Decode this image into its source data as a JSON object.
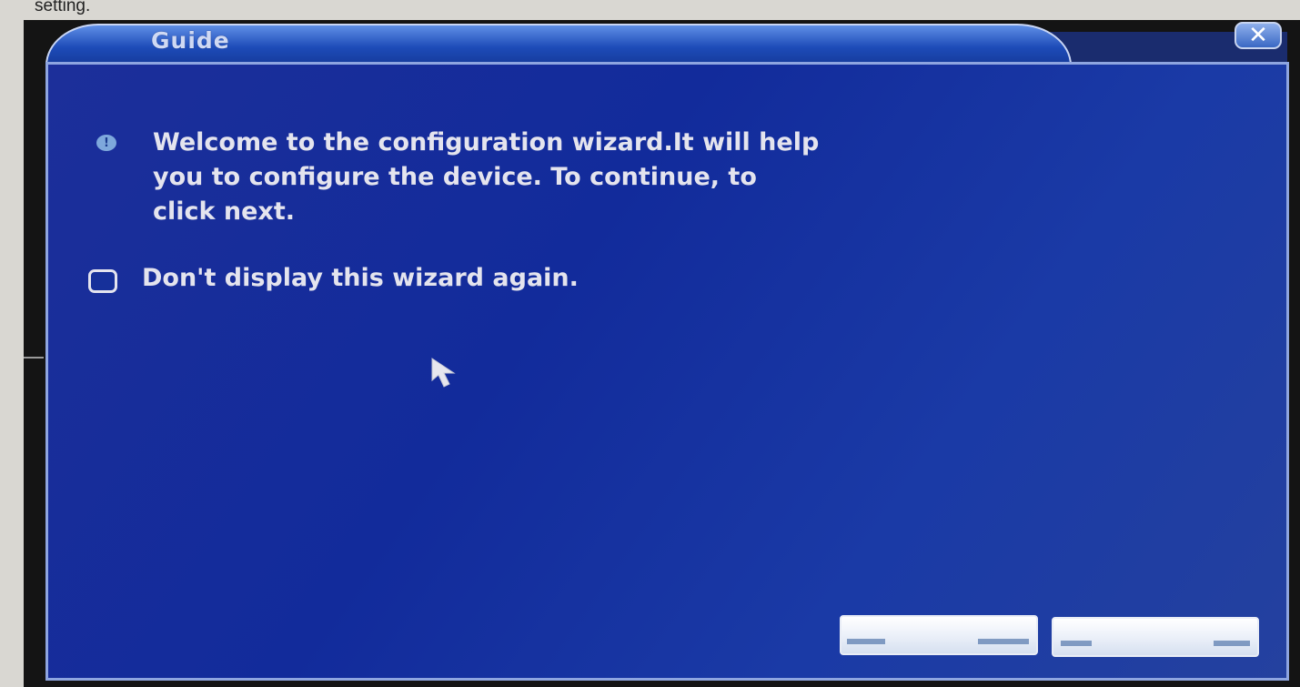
{
  "page_caption": "setting.",
  "window": {
    "title": "Guide",
    "close_icon": "close-icon",
    "accent_color": "#1d4bb8",
    "body_color": "#152f9c"
  },
  "content": {
    "info_icon": "info-icon",
    "message": "Welcome to the configuration wizard.It will help\n you to configure the device. To continue, to\n click next.",
    "checkbox": {
      "label": "Don't display this wizard again.",
      "checked": false
    },
    "cursor_icon": "mouse-pointer-icon"
  },
  "buttons": [
    {
      "label": ""
    },
    {
      "label": ""
    }
  ]
}
